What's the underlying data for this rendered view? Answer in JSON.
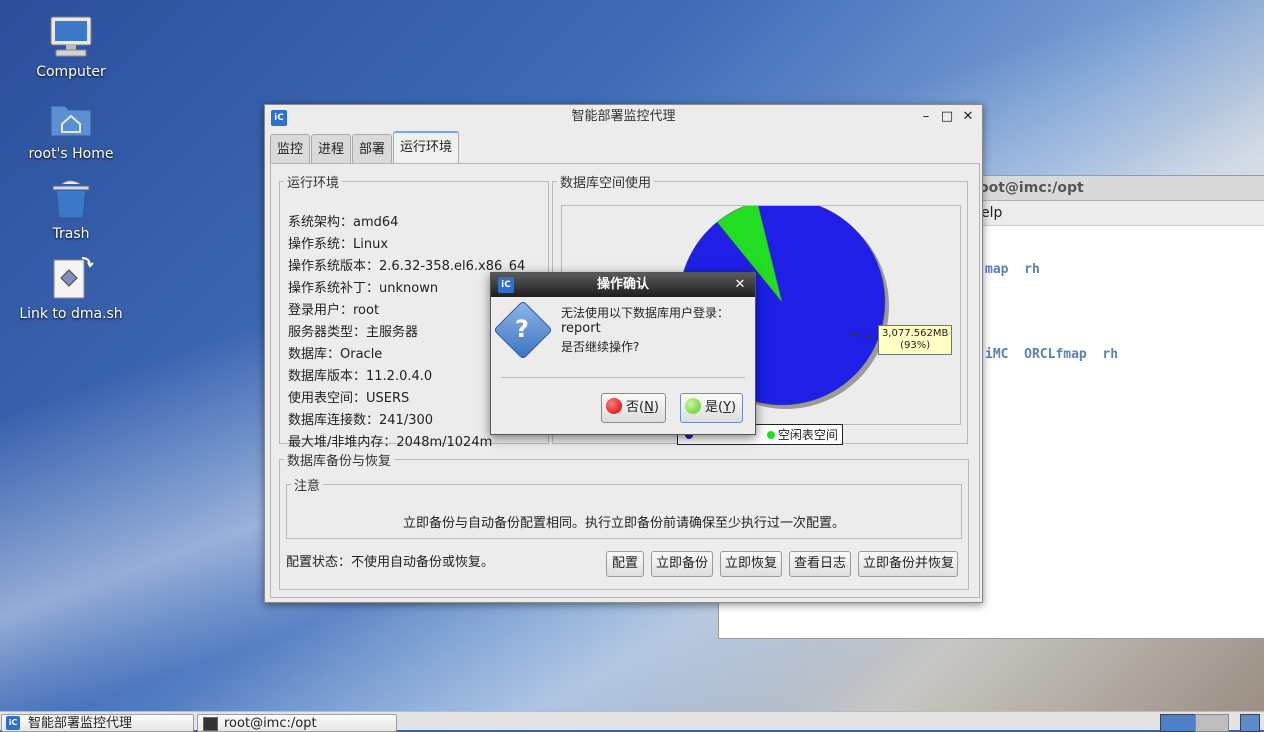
{
  "desktop": {
    "icons": [
      {
        "label": "Computer"
      },
      {
        "label": "root's Home"
      },
      {
        "label": "Trash"
      },
      {
        "label": "Link to dma.sh"
      }
    ]
  },
  "terminal": {
    "title": "oot@imc:/opt",
    "menu": "elp",
    "line1": "map  rh",
    "line2": "iMC  ORCLfmap  rh"
  },
  "window": {
    "title": "智能部署监控代理",
    "app_icon": "iC",
    "controls": {
      "minimize": "–",
      "maximize": "□",
      "close": "✕"
    },
    "tabs": [
      {
        "label": "监控",
        "active": false
      },
      {
        "label": "进程",
        "active": false
      },
      {
        "label": "部署",
        "active": false
      },
      {
        "label": "运行环境",
        "active": true
      }
    ]
  },
  "env": {
    "legend": "运行环境",
    "rows": [
      "系统架构：amd64",
      "操作系统：Linux",
      "操作系统版本：2.6.32-358.el6.x86_64",
      "操作系统补丁：unknown",
      "登录用户：root",
      "服务器类型：主服务器",
      "数据库：Oracle",
      "数据库版本：11.2.0.4.0",
      "使用表空间：USERS",
      "数据库连接数：241/300",
      "最大堆/非堆内存：2048m/1024m"
    ]
  },
  "db_space": {
    "legend": "数据库空间使用",
    "colors": {
      "used": "#1f1fe8",
      "free": "#22dd22",
      "shadow": "#9a9a9a"
    },
    "legend_free": "空闲表空间",
    "big_label": {
      "value": "3,077.562MB",
      "pct": "(93%)"
    }
  },
  "chart_data": {
    "type": "pie",
    "slices": [
      {
        "name": "空闲表空间",
        "value": 3077.562,
        "pct": 93
      },
      {
        "name": "",
        "pct": 7
      }
    ]
  },
  "backup": {
    "legend": "数据库备份与恢复",
    "notice_legend": "注意",
    "notice_text": "立即备份与自动备份配置相同。执行立即备份前请确保至少执行过一次配置。",
    "status": "配置状态：不使用自动备份或恢复。",
    "buttons": {
      "config": "配置",
      "backup_now": "立即备份",
      "restore_now": "立即恢复",
      "view_log": "查看日志",
      "backup_restore": "立即备份并恢复"
    }
  },
  "dialog": {
    "title": "操作确认",
    "close": "✕",
    "line1": "无法使用以下数据库用户登录：",
    "line2": "report",
    "line3": "是否继续操作?",
    "no_prefix": "否(",
    "no_key": "N",
    "yes_prefix": "是(",
    "yes_key": "Y",
    "suffix": ")",
    "colors": {
      "no": "#d40000",
      "yes": "#5cc82e"
    }
  },
  "taskbar": {
    "items": [
      {
        "label": "智能部署监控代理"
      },
      {
        "label": "root@imc:/opt"
      }
    ]
  }
}
